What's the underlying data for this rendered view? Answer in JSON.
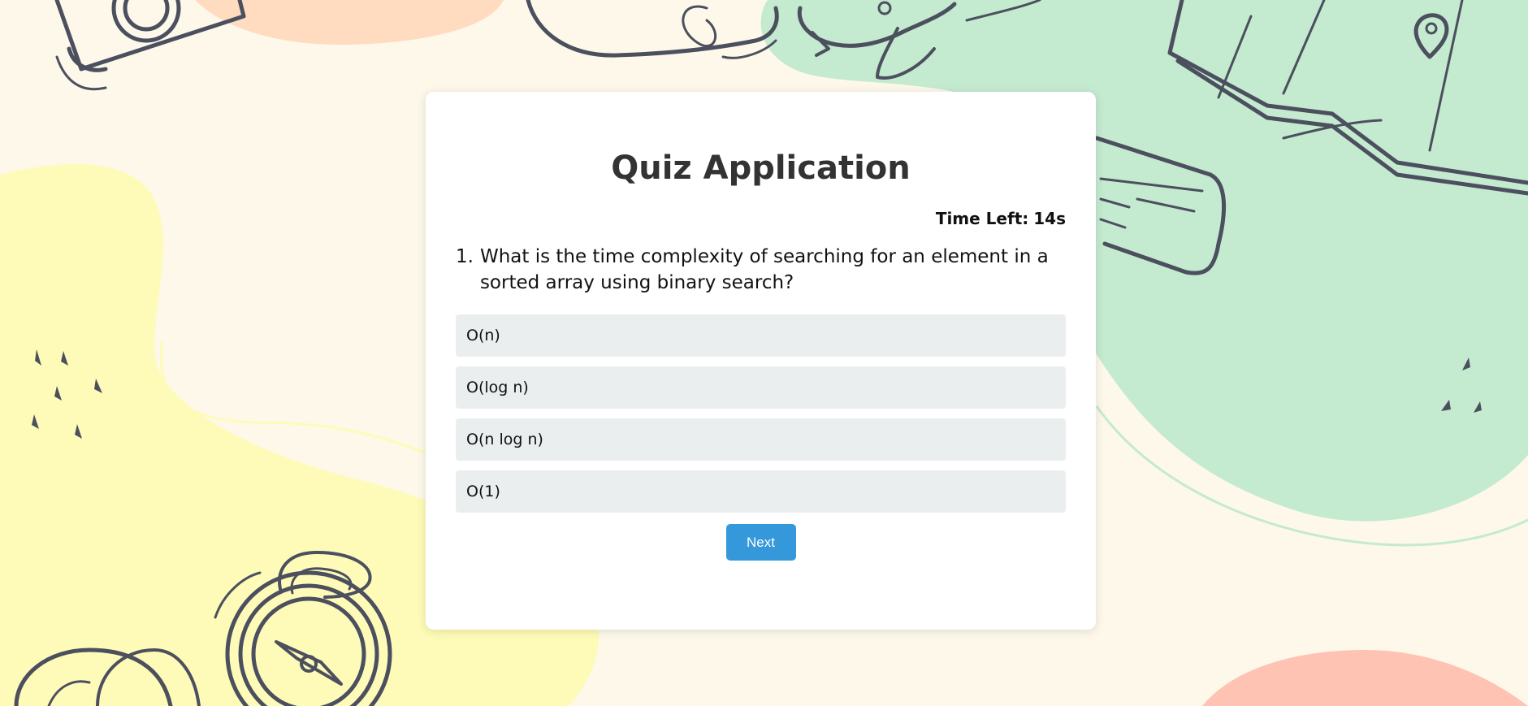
{
  "app": {
    "title": "Quiz Application"
  },
  "timer": {
    "label": "Time Left:",
    "value": "14s"
  },
  "question": {
    "number": "1.",
    "text": "What is the time complexity of searching for an element in a sorted array using binary search?"
  },
  "options": [
    {
      "label": "O(n)"
    },
    {
      "label": "O(log n)"
    },
    {
      "label": "O(n log n)"
    },
    {
      "label": "O(1)"
    }
  ],
  "actions": {
    "next_label": "Next"
  },
  "colors": {
    "accent": "#3498db",
    "background": "#fdf8ea",
    "blob_green": "#c4ead0",
    "blob_yellow": "#fefbb8",
    "blob_peach": "#ffdcc0",
    "blob_salmon": "#ffc3b4",
    "doodle_stroke": "#4b4f5e"
  },
  "background_art": {
    "icons": [
      "camera-doodle-icon",
      "airplane-doodle-icon",
      "map-doodle-icon",
      "location-pin-icon",
      "ticket-doodle-icon",
      "compass-doodle-icon"
    ]
  }
}
